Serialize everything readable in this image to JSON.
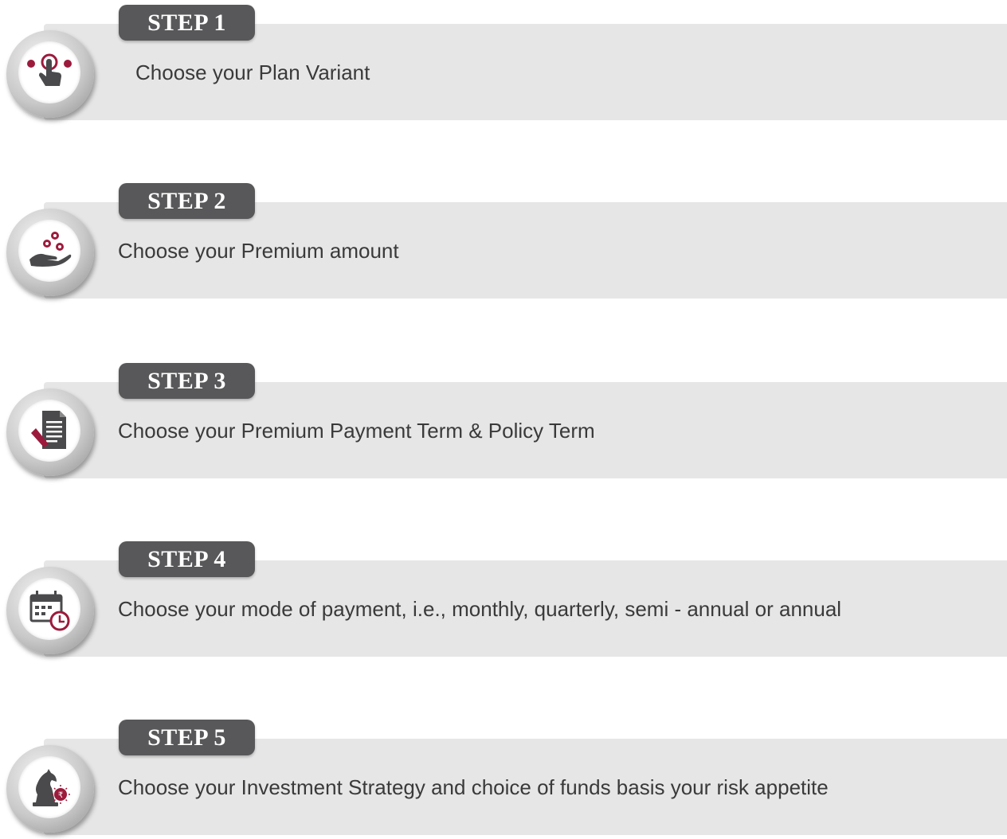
{
  "colors": {
    "accent": "#9c1b3c",
    "icon_dark": "#4a4a4c",
    "pill": "#58585a",
    "bar": "#e6e6e6",
    "text": "#3a3a3a"
  },
  "steps": [
    {
      "label": "STEP 1",
      "text": "Choose your Plan Variant",
      "icon": "tap-choice-icon"
    },
    {
      "label": "STEP 2",
      "text": "Choose your Premium amount",
      "icon": "hand-coins-icon"
    },
    {
      "label": "STEP 3",
      "text": "Choose your Premium Payment Term & Policy Term",
      "icon": "document-pen-icon"
    },
    {
      "label": "STEP 4",
      "text": "Choose your mode of payment, i.e., monthly, quarterly, semi - annual or annual",
      "icon": "calendar-clock-icon"
    },
    {
      "label": "STEP 5",
      "text": "Choose your Investment Strategy and choice of funds basis your risk appetite",
      "icon": "chess-knight-rupee-icon"
    }
  ]
}
